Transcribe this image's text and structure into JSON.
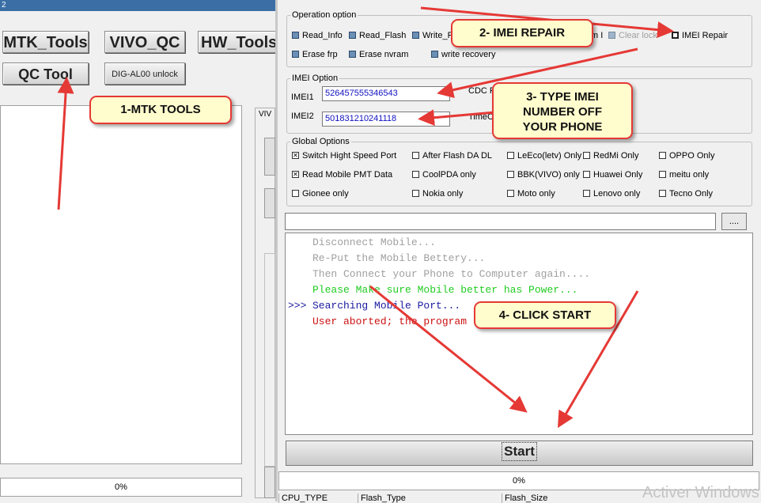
{
  "back_window": {
    "title_fragment": "2",
    "buttons": [
      "MTK_Tools",
      "VIVO_QC",
      "HW_Tools",
      "QC Tool"
    ],
    "unlock_button": "DIG-AL00 unlock",
    "tab_fragment": "VIV",
    "progress_text": "0%"
  },
  "operation_option": {
    "title": "Operation option",
    "row1": [
      "Read_Info",
      "Read_Flash",
      "Write_F"
    ],
    "fragment": "m I",
    "clear_lock": "Clear lock",
    "imei_repair": "IMEI Repair",
    "row2": [
      "Erase frp",
      "Erase nvram",
      "write recovery"
    ]
  },
  "imei_option": {
    "title": "IMEI Option",
    "imei1_label": "IMEI1",
    "imei1_value": "526457555346543",
    "imei2_label": "IMEI2",
    "imei2_value": "501831210241118",
    "cdc_fragment": "CDC F",
    "time_fragment": "TimeC"
  },
  "global_options": {
    "title": "Global Options",
    "rows": [
      [
        "Switch Hight Speed Port",
        "After Flash DA DL",
        "LeEco(letv) Only",
        "RedMi Only",
        "OPPO Only"
      ],
      [
        "Read Mobile PMT Data",
        "CoolPDA only",
        "BBK(VIVO) only",
        "Huawei Only",
        "meitu only"
      ],
      [
        "Gionee only",
        "Nokia only",
        "Moto only",
        "Lenovo only",
        "Tecno Only"
      ]
    ]
  },
  "browse_label": "....",
  "log": {
    "prompt": ">>>",
    "lines": [
      {
        "text": "Disconnect Mobile...",
        "color": "#a0a0a0"
      },
      {
        "text": "Re-Put the Mobile Bettery...",
        "color": "#a0a0a0"
      },
      {
        "text": "Then Connect your Phone to Computer again....",
        "color": "#a0a0a0"
      },
      {
        "text": "Please Make sure Mobile better has Power...",
        "color": "#22cc22"
      },
      {
        "text": "Searching Mobile Port...",
        "color": "#1a1aa0"
      },
      {
        "text": "User aborted; the program",
        "color": "#cc1111"
      }
    ]
  },
  "start_label": "Start",
  "progress_text": "0%",
  "table_headers": [
    "CPU_TYPE",
    "Flash_Type",
    "Flash_Size"
  ],
  "watermark": "Activer Windows",
  "callouts": {
    "mtk": "1-MTK TOOLS",
    "imei_repair": "2- IMEI REPAIR",
    "type_imei": "3- TYPE IMEI NUMBER OFF YOUR PHONE",
    "click_start": "4- CLICK START"
  },
  "colors": {
    "annotation_red": "#e53935",
    "callout_fill": "#fffccd"
  }
}
